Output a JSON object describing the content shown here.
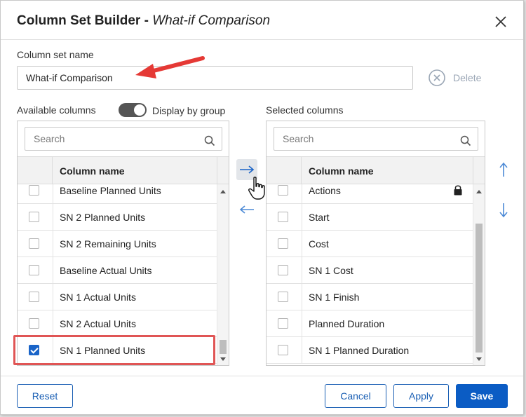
{
  "dialog": {
    "title": "Column Set Builder - ",
    "subtitle": "What-if Comparison"
  },
  "column_set": {
    "label": "Column set name",
    "value": "What-if Comparison",
    "delete_label": "Delete"
  },
  "available": {
    "label": "Available columns",
    "toggle_label": "Display by group",
    "toggle_on": true,
    "search_placeholder": "Search",
    "header": "Column name",
    "rows": [
      {
        "label": "Baseline Planned Units",
        "checked": false
      },
      {
        "label": "SN 2 Planned Units",
        "checked": false
      },
      {
        "label": "SN 2 Remaining Units",
        "checked": false
      },
      {
        "label": "Baseline Actual Units",
        "checked": false
      },
      {
        "label": "SN 1 Actual Units",
        "checked": false
      },
      {
        "label": "SN 2 Actual Units",
        "checked": false
      },
      {
        "label": "SN 1 Planned Units",
        "checked": true
      }
    ]
  },
  "selected": {
    "label": "Selected columns",
    "search_placeholder": "Search",
    "header": "Column name",
    "rows": [
      {
        "label": "Actions",
        "checked": false,
        "locked": true
      },
      {
        "label": "Start",
        "checked": false
      },
      {
        "label": "Cost",
        "checked": false
      },
      {
        "label": "SN 1 Cost",
        "checked": false
      },
      {
        "label": "SN 1 Finish",
        "checked": false
      },
      {
        "label": "Planned Duration",
        "checked": false
      },
      {
        "label": "SN 1 Planned Duration",
        "checked": false
      }
    ]
  },
  "footer": {
    "reset": "Reset",
    "cancel": "Cancel",
    "apply": "Apply",
    "save": "Save"
  },
  "colors": {
    "accent": "#1a64c8",
    "primary_button": "#0b5cc4",
    "annotation_red": "#e53935",
    "disabled": "#9aa6b5"
  },
  "icons": [
    "close-icon",
    "delete-circle-x-icon",
    "search-icon",
    "arrow-right-icon",
    "arrow-left-icon",
    "arrow-up-icon",
    "arrow-down-icon",
    "lock-icon",
    "hand-cursor-icon"
  ]
}
